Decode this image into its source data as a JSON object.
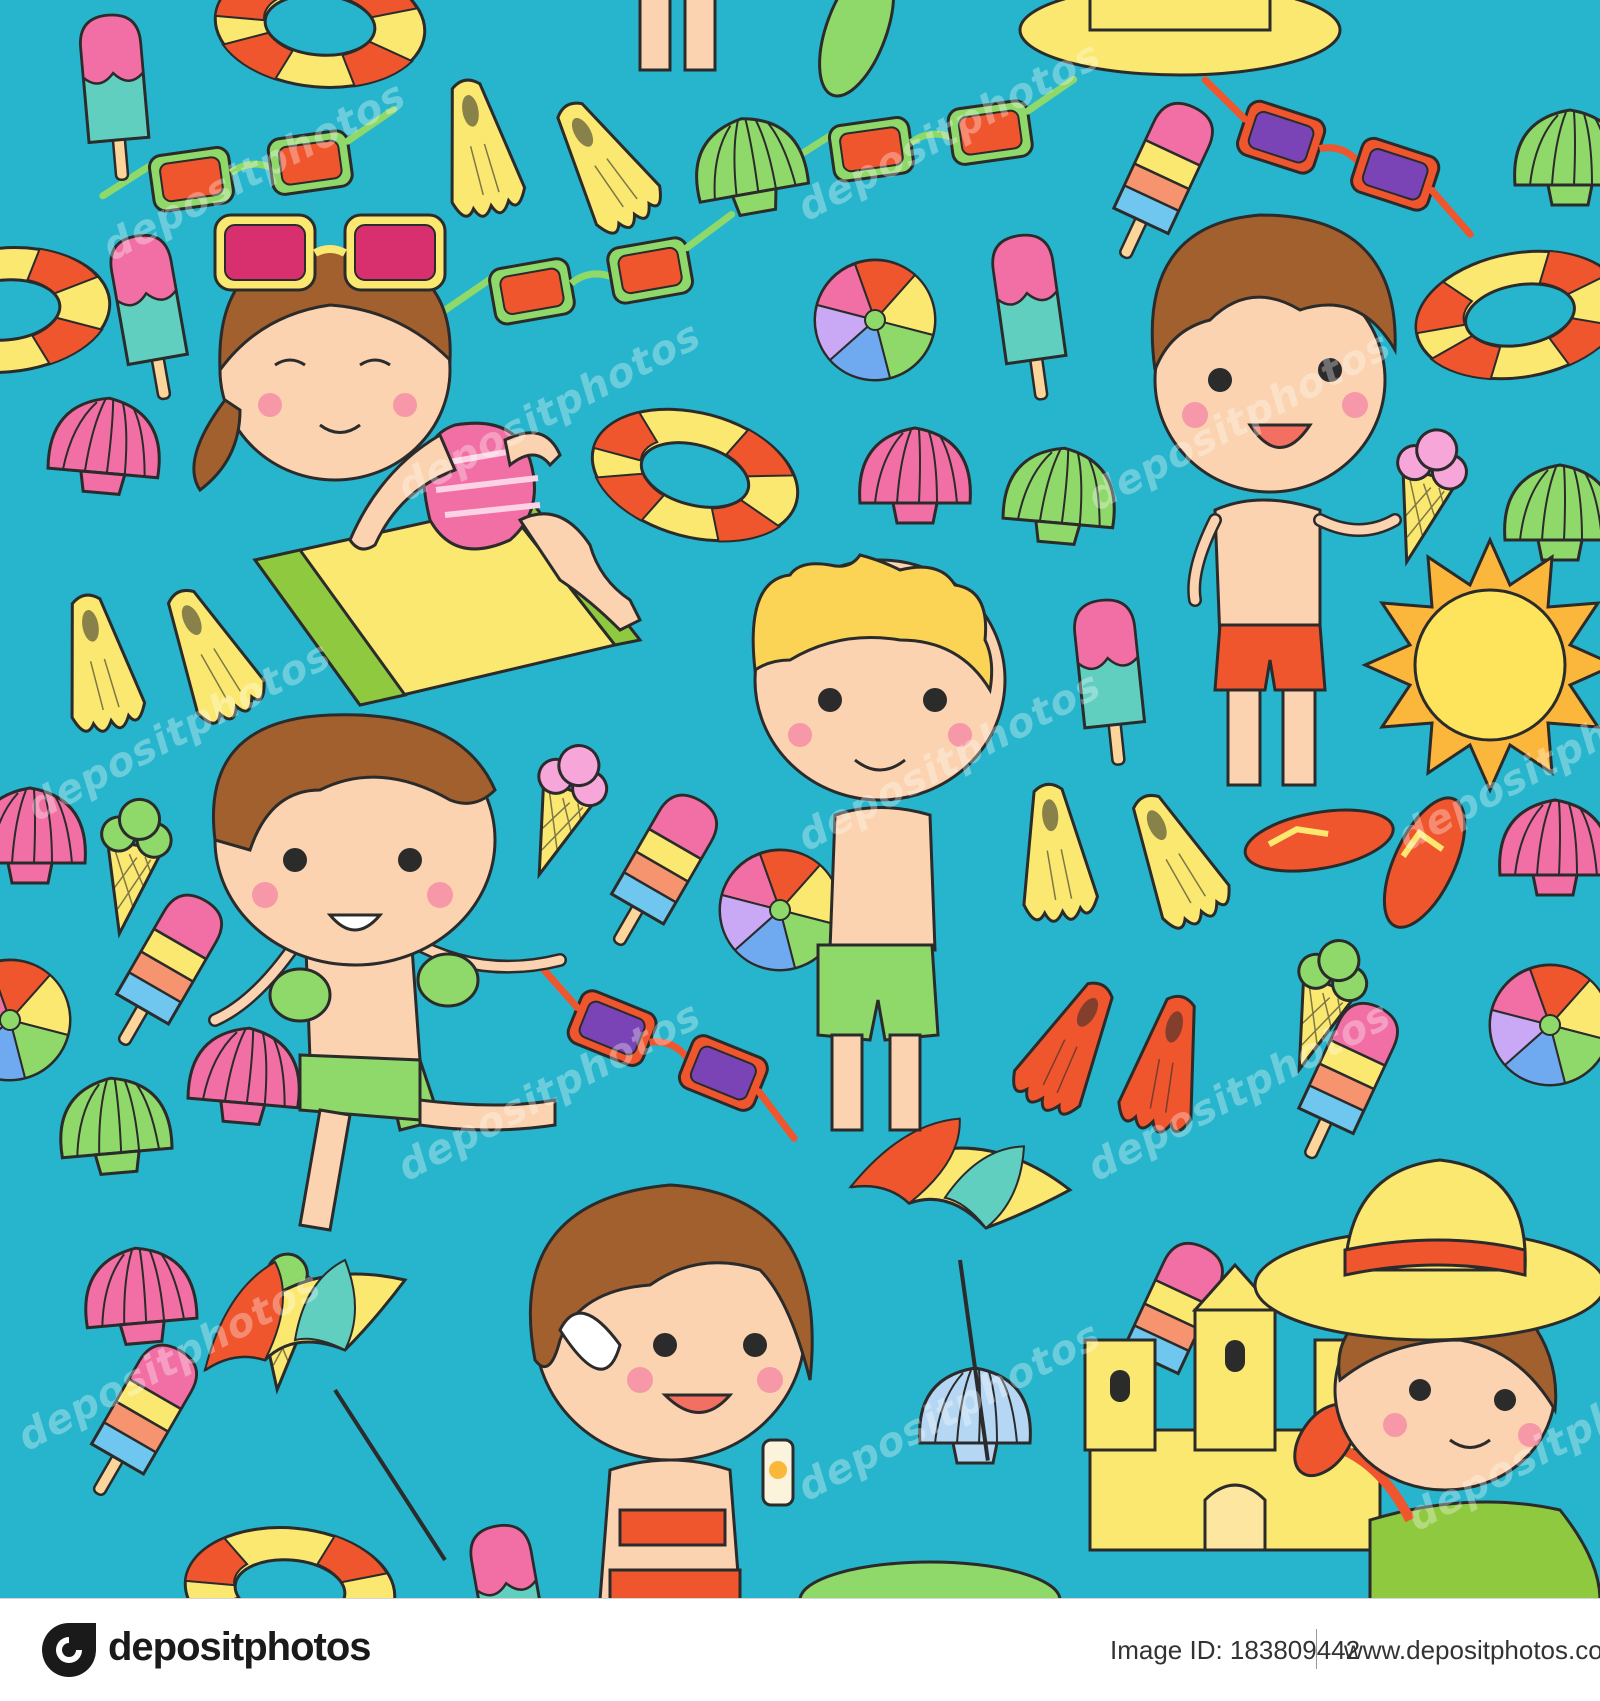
{
  "illustration": {
    "background": "#26b5cc",
    "watermark_text": "depositphotos",
    "palette": {
      "pink": "#f26fa6",
      "yellow": "#fbe870",
      "orange": "#f0562e",
      "green": "#8fd86a",
      "teal": "#61cfc0",
      "purple": "#7a44b6",
      "skin": "#fbd3b0",
      "outline": "#2b2b2b"
    },
    "motifs": [
      "girl-sunbathing",
      "boy-with-ice-cream",
      "boy-with-beach-ball",
      "boy-with-armbands",
      "girl-with-sunscreen",
      "girl-with-sun-hat",
      "sunglasses",
      "swim-fins",
      "seashell",
      "popsicle",
      "ice-cream-cone",
      "beach-ball",
      "swim-ring",
      "beach-umbrella",
      "sandcastle",
      "sun",
      "flip-flops"
    ]
  },
  "footer": {
    "brand": "depositphotos",
    "image_id": "Image ID: 183809442",
    "site": "www.depositphotos.com"
  }
}
